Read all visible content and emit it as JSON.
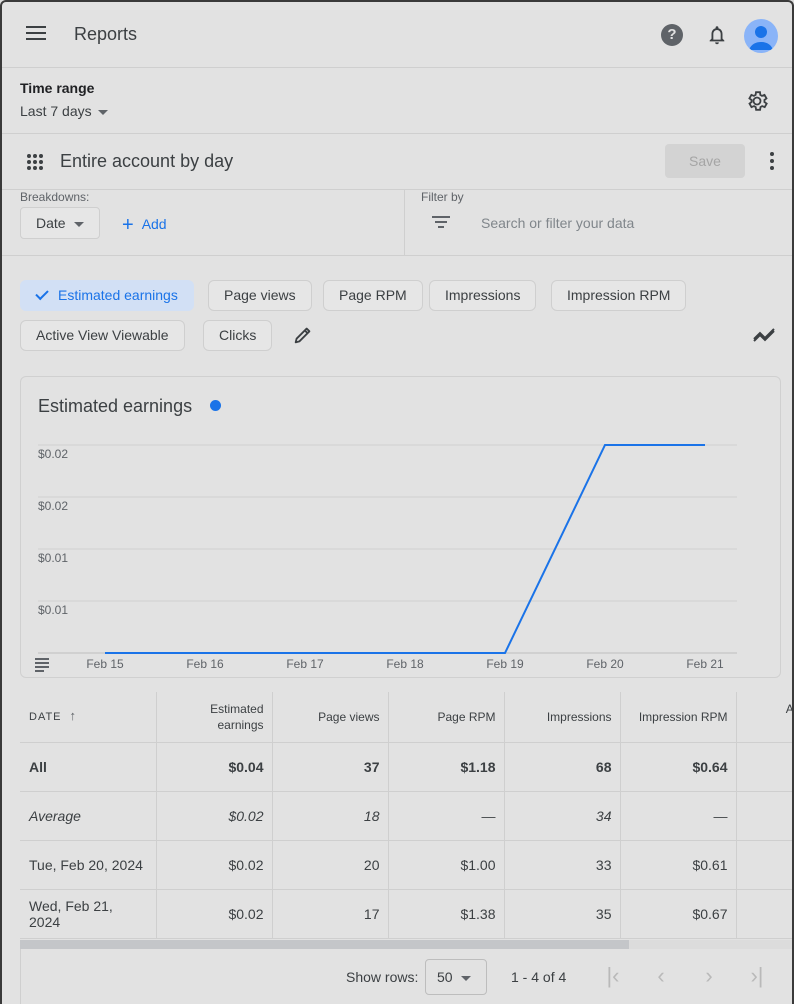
{
  "header": {
    "title": "Reports",
    "help_glyph": "?"
  },
  "time_range": {
    "label": "Time range",
    "value": "Last 7 days"
  },
  "report": {
    "title": "Entire account by day",
    "save_label": "Save"
  },
  "breakdowns": {
    "label": "Breakdowns:",
    "date_chip": "Date",
    "add_label": "Add"
  },
  "filter": {
    "label": "Filter by",
    "placeholder": "Search or filter your data"
  },
  "metrics": [
    {
      "label": "Estimated earnings",
      "selected": true
    },
    {
      "label": "Page views",
      "selected": false
    },
    {
      "label": "Page RPM",
      "selected": false
    },
    {
      "label": "Impressions",
      "selected": false
    },
    {
      "label": "Impression RPM",
      "selected": false
    },
    {
      "label": "Active View Viewable",
      "selected": false
    },
    {
      "label": "Clicks",
      "selected": false
    }
  ],
  "chart_data": {
    "type": "line",
    "title": "Estimated earnings",
    "x": [
      "Feb 15",
      "Feb 16",
      "Feb 17",
      "Feb 18",
      "Feb 19",
      "Feb 20",
      "Feb 21"
    ],
    "y_tick_labels": [
      "$0.02",
      "$0.02",
      "$0.01",
      "$0.01"
    ],
    "series": [
      {
        "values": [
          0,
          0,
          0,
          0,
          0,
          0.02,
          0.02
        ],
        "color": "#1a73e8"
      }
    ],
    "ylim": [
      0,
      0.02
    ],
    "grid": true
  },
  "table": {
    "columns": [
      "DATE",
      "Estimated earnings",
      "Page views",
      "Page RPM",
      "Impressions",
      "Impression RPM",
      "Active View Viewable"
    ],
    "rows": [
      {
        "kind": "all",
        "cells": [
          "All",
          "$0.04",
          "37",
          "$1.18",
          "68",
          "$0.64",
          ""
        ]
      },
      {
        "kind": "avg",
        "cells": [
          "Average",
          "$0.02",
          "18",
          "—",
          "34",
          "—",
          ""
        ]
      },
      {
        "kind": "data",
        "cells": [
          "Tue, Feb 20, 2024",
          "$0.02",
          "20",
          "$1.00",
          "33",
          "$0.61",
          ""
        ]
      },
      {
        "kind": "data",
        "cells": [
          "Wed, Feb 21, 2024",
          "$0.02",
          "17",
          "$1.38",
          "35",
          "$0.67",
          ""
        ]
      }
    ]
  },
  "pagination": {
    "show_rows_label": "Show rows:",
    "rows_value": "50",
    "range_text": "1 - 4 of 4"
  },
  "colors": {
    "accent": "#1a73e8",
    "background": "#e2e2e2"
  }
}
